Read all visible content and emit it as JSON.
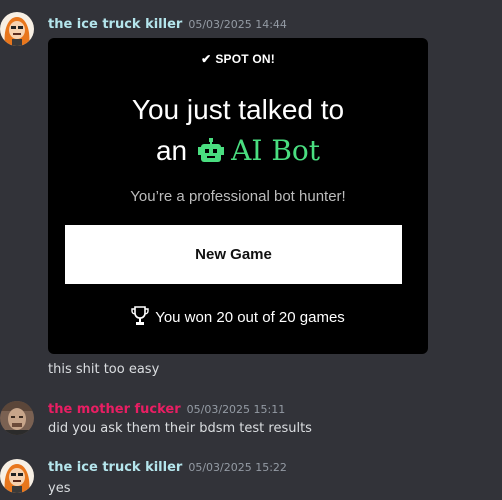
{
  "messages": [
    {
      "username": "the ice truck killer",
      "username_color": "#b4e5ec",
      "timestamp": "05/03/2025 14:44",
      "avatar": "orange-haired-avatar"
    },
    {
      "text": "this shit too easy"
    },
    {
      "username": "the mother fucker",
      "username_color": "#e91e63",
      "timestamp": "05/03/2025 15:11",
      "avatar": "man-photo-avatar",
      "text": "did you ask them their bdsm test results"
    },
    {
      "username": "the ice truck killer",
      "username_color": "#b4e5ec",
      "timestamp": "05/03/2025 15:22",
      "avatar": "orange-haired-avatar",
      "text": "yes"
    }
  ],
  "card": {
    "result_label": "SPOT ON!",
    "check_icon": "check-icon",
    "headline_line1": "You just talked to",
    "headline_prefix": "an",
    "bot_icon": "robot-icon",
    "bot_name": "AI Bot",
    "bot_name_color": "#4ade80",
    "tagline": "You’re a professional bot hunter!",
    "button_label": "New Game",
    "trophy_icon": "trophy-icon",
    "score_text": "You won 20 out of 20 games"
  }
}
